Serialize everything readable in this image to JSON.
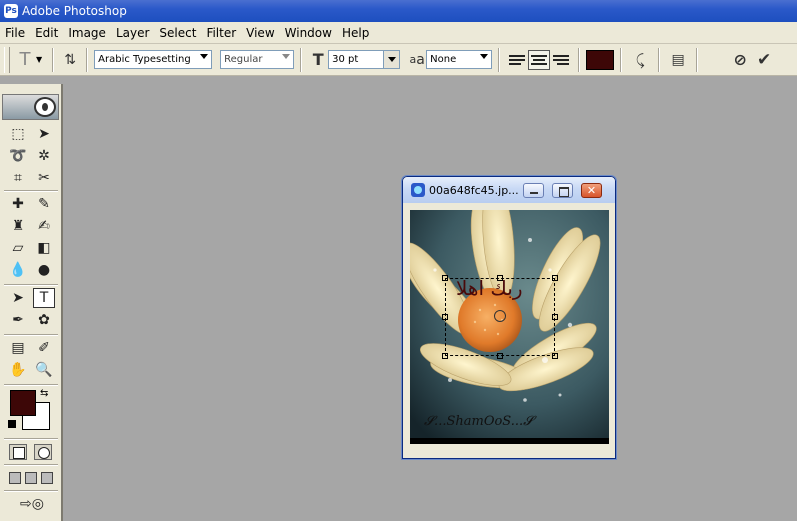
{
  "app": {
    "title": "Adobe Photoshop",
    "icon": "photoshop-icon"
  },
  "menu": [
    "File",
    "Edit",
    "Image",
    "Layer",
    "Select",
    "Filter",
    "View",
    "Window",
    "Help"
  ],
  "options": {
    "tool_icon": "T",
    "orientation_icon": "text-orientation-icon",
    "font_family": "Arabic Typesetting",
    "font_style": "Regular",
    "font_size": "30 pt",
    "aa_label": "a",
    "antialias": "None",
    "text_color": "#3d0707"
  },
  "colors": {
    "foreground": "#3d0707",
    "background": "#ffffff"
  },
  "document": {
    "title": "00a648fc45.jp...",
    "text_layer": "ربك اهلا",
    "signature": "𝓢...ShamOoS...𝓢"
  }
}
